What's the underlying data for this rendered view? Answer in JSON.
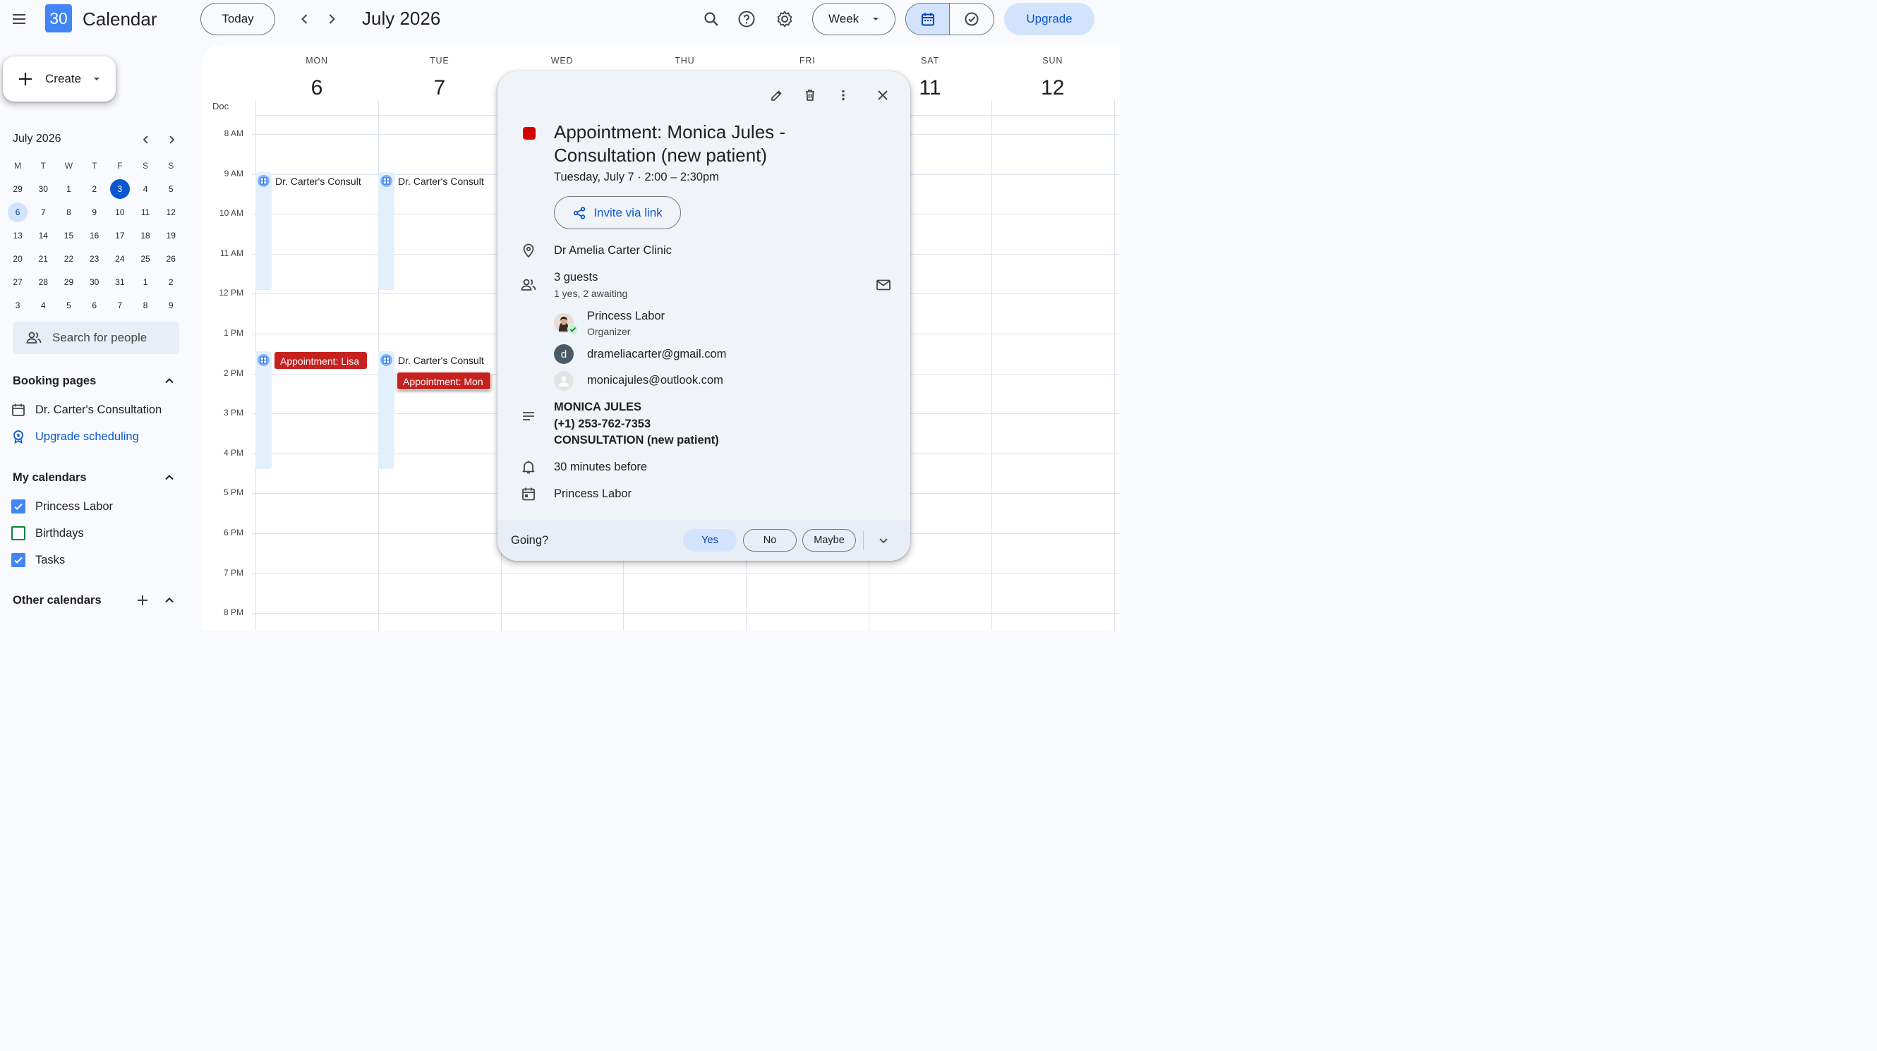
{
  "header": {
    "app_title": "Calendar",
    "logo_text": "30",
    "today_label": "Today",
    "current_period": "July 2026",
    "view_label": "Week",
    "upgrade_label": "Upgrade"
  },
  "sidebar": {
    "create_label": "Create",
    "mini_calendar": {
      "title": "July 2026",
      "weekdays": [
        "M",
        "T",
        "W",
        "T",
        "F",
        "S",
        "S"
      ],
      "weeks": [
        [
          "29",
          "30",
          "1",
          "2",
          "3",
          "4",
          "5"
        ],
        [
          "6",
          "7",
          "8",
          "9",
          "10",
          "11",
          "12"
        ],
        [
          "13",
          "14",
          "15",
          "16",
          "17",
          "18",
          "19"
        ],
        [
          "20",
          "21",
          "22",
          "23",
          "24",
          "25",
          "26"
        ],
        [
          "27",
          "28",
          "29",
          "30",
          "31",
          "1",
          "2"
        ],
        [
          "3",
          "4",
          "5",
          "6",
          "7",
          "8",
          "9"
        ]
      ],
      "today": "3",
      "selected": "6"
    },
    "search_people_placeholder": "Search for people",
    "booking_pages": {
      "title": "Booking pages",
      "items": [
        "Dr. Carter's Consultation"
      ],
      "upgrade_link": "Upgrade scheduling"
    },
    "my_calendars": {
      "title": "My calendars",
      "items": [
        {
          "label": "Princess Labor",
          "checked": true,
          "color": "#4285f4"
        },
        {
          "label": "Birthdays",
          "checked": false,
          "color": "#0b8043"
        },
        {
          "label": "Tasks",
          "checked": true,
          "color": "#4285f4"
        }
      ]
    },
    "other_calendars": {
      "title": "Other calendars"
    }
  },
  "grid": {
    "timezone_label": "Doc",
    "days": [
      {
        "dow": "MON",
        "num": "6"
      },
      {
        "dow": "TUE",
        "num": "7"
      },
      {
        "dow": "WED",
        "num": ""
      },
      {
        "dow": "THU",
        "num": ""
      },
      {
        "dow": "FRI",
        "num": ""
      },
      {
        "dow": "SAT",
        "num": "11"
      },
      {
        "dow": "SUN",
        "num": "12"
      }
    ],
    "hours": [
      "8 AM",
      "9 AM",
      "10 AM",
      "11 AM",
      "12 PM",
      "1 PM",
      "2 PM",
      "3 PM",
      "4 PM",
      "5 PM",
      "6 PM",
      "7 PM",
      "8 PM"
    ],
    "events": {
      "mon_morning": "Dr. Carter's Consult",
      "tue_morning": "Dr. Carter's Consult",
      "mon_appt": "Appointment: Lisa",
      "tue_afternoon": "Dr. Carter's Consult",
      "tue_appt": "Appointment: Mon"
    }
  },
  "popup": {
    "title": "Appointment: Monica Jules - Consultation (new patient)",
    "color": "#d50000",
    "date_time": "Tuesday, July 7  ·  2:00 – 2:30pm",
    "invite_label": "Invite via link",
    "location": "Dr Amelia Carter Clinic",
    "guests_count": "3 guests",
    "guests_summary": "1 yes, 2 awaiting",
    "guests": [
      {
        "name": "Princess Labor",
        "role": "Organizer",
        "initial": ""
      },
      {
        "name": "drameliacarter@gmail.com",
        "role": "",
        "initial": "d"
      },
      {
        "name": "monicajules@outlook.com",
        "role": "",
        "initial": ""
      }
    ],
    "description": [
      "MONICA JULES",
      "(+1) 253-762-7353",
      "CONSULTATION (new patient)"
    ],
    "reminder": "30 minutes before",
    "calendar": "Princess Labor",
    "going_label": "Going?",
    "rsvp": {
      "yes": "Yes",
      "no": "No",
      "maybe": "Maybe"
    }
  }
}
